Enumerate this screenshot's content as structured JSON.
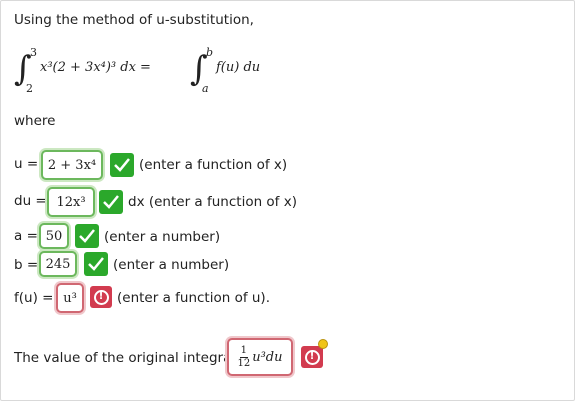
{
  "intro": "Using the method of u-substitution,",
  "integral": {
    "lower": "2",
    "upper": "3",
    "integrand_html": "x³(2 + 3x⁴)³ dx =",
    "rhs_lower": "a",
    "rhs_upper": "b",
    "rhs_integrand": "f(u) du"
  },
  "where": "where",
  "rows": [
    {
      "label": "u =",
      "value": "2 + 3x⁴",
      "status": "correct",
      "hint": "(enter a function of x)"
    },
    {
      "label": "du =",
      "value": "12x³",
      "status": "correct",
      "hint": "dx (enter a function of x)"
    },
    {
      "label": "a =",
      "value": "50",
      "status": "correct",
      "hint": "(enter a number)"
    },
    {
      "label": "b =",
      "value": "245",
      "status": "correct",
      "hint": "(enter a number)"
    },
    {
      "label": "f(u) =",
      "value": "u³",
      "status": "incorrect",
      "hint": "(enter a function of u)."
    }
  ],
  "final": {
    "label": "The value of the original integral is",
    "frac_num": "1",
    "frac_den": "12",
    "value": "u³du",
    "status": "incorrect"
  },
  "colors": {
    "correct": "#2ba82b",
    "incorrect": "#d23b4f"
  }
}
